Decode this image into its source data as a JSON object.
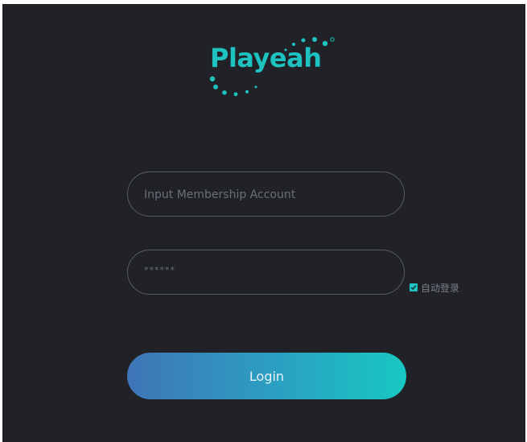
{
  "brand": {
    "name": "Playeah",
    "accent_color": "#1ec2c1",
    "logo_icon": "playeah-logo-icon"
  },
  "form": {
    "account_placeholder": "Input Membership Account",
    "password_value": "******",
    "auto_login": {
      "label": "自动登录",
      "checked": true
    },
    "login_label": "Login"
  },
  "colors": {
    "background": "#202227",
    "field_border": "#585c64",
    "button_gradient_start": "#3f75b7",
    "button_gradient_end": "#17c8c2"
  }
}
